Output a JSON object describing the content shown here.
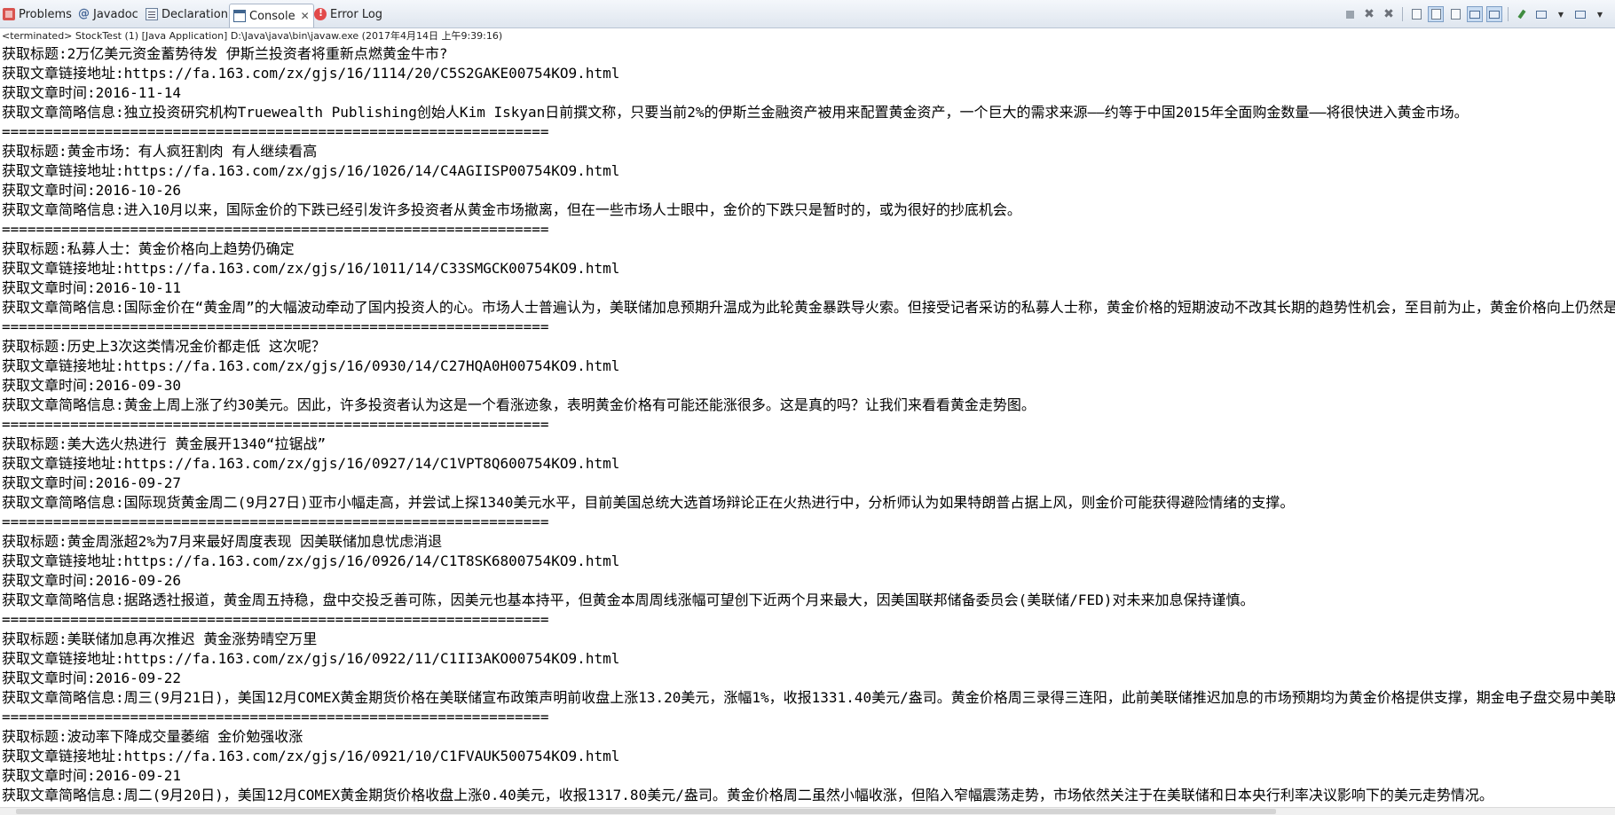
{
  "tabs": [
    {
      "label": "Problems",
      "icon": "problems-icon"
    },
    {
      "label": "Javadoc",
      "icon": "javadoc-icon"
    },
    {
      "label": "Declaration",
      "icon": "declaration-icon"
    },
    {
      "label": "Console",
      "icon": "console-icon",
      "active": true
    },
    {
      "label": "Error Log",
      "icon": "error-log-icon"
    }
  ],
  "status_line": "<terminated> StockTest (1) [Java Application] D:\\Java\\java\\bin\\javaw.exe (2017年4月14日 上午9:39:16)",
  "separator": "================================================================",
  "labels": {
    "title": "获取标题:",
    "link": "获取文章链接地址:",
    "time": "获取文章时间:",
    "summary": "获取文章简略信息:"
  },
  "articles": [
    {
      "title": "2万亿美元资金蓄势待发 伊斯兰投资者将重新点燃黄金牛市?",
      "link": "https://fa.163.com/zx/gjs/16/1114/20/C5S2GAKE00754KO9.html",
      "time": "2016-11-14",
      "summary": "独立投资研究机构Truewealth Publishing创始人Kim Iskyan日前撰文称，只要当前2%的伊斯兰金融资产被用来配置黄金资产，一个巨大的需求来源——约等于中国2015年全面购金数量——将很快进入黄金市场。"
    },
    {
      "title": "黄金市场：有人疯狂割肉 有人继续看高",
      "link": "https://fa.163.com/zx/gjs/16/1026/14/C4AGIISP00754KO9.html",
      "time": "2016-10-26",
      "summary": "进入10月以来，国际金价的下跌已经引发许多投资者从黄金市场撤离，但在一些市场人士眼中，金价的下跌只是暂时的，或为很好的抄底机会。"
    },
    {
      "title": "私募人士：黄金价格向上趋势仍确定",
      "link": "https://fa.163.com/zx/gjs/16/1011/14/C33SMGCK00754KO9.html",
      "time": "2016-10-11",
      "summary": "国际金价在“黄金周”的大幅波动牵动了国内投资人的心。市场人士普遍认为，美联储加息预期升温成为此轮黄金暴跌导火索。但接受记者采访的私募人士称，黄金价格的短期波动不改其长期的趋势性机会，至目前为止，黄金价格向上仍然是最确定的投资机会"
    },
    {
      "title": "历史上3次这类情况金价都走低 这次呢？",
      "link": "https://fa.163.com/zx/gjs/16/0930/14/C27HQA0H00754KO9.html",
      "time": "2016-09-30",
      "summary": "黄金上周上涨了约30美元。因此，许多投资者认为这是一个看涨迹象，表明黄金价格有可能还能涨很多。这是真的吗？让我们来看看黄金走势图。"
    },
    {
      "title": "美大选火热进行 黄金展开1340“拉锯战”",
      "link": "https://fa.163.com/zx/gjs/16/0927/14/C1VPT8Q600754KO9.html",
      "time": "2016-09-27",
      "summary": "国际现货黄金周二(9月27日)亚市小幅走高，并尝试上探1340美元水平，目前美国总统大选首场辩论正在火热进行中，分析师认为如果特朗普占据上风，则金价可能获得避险情绪的支撑。"
    },
    {
      "title": "黄金周涨超2%为7月来最好周度表现 因美联储加息忧虑消退",
      "link": "https://fa.163.com/zx/gjs/16/0926/14/C1T8SK6800754KO9.html",
      "time": "2016-09-26",
      "summary": "据路透社报道，黄金周五持稳，盘中交投乏善可陈，因美元也基本持平，但黄金本周周线涨幅可望创下近两个月来最大，因美国联邦储备委员会(美联储/FED)对未来加息保持谨慎。"
    },
    {
      "title": "美联储加息再次推迟 黄金涨势晴空万里",
      "link": "https://fa.163.com/zx/gjs/16/0922/11/C1II3AKO00754KO9.html",
      "time": "2016-09-22",
      "summary": "周三(9月21日)，美国12月COMEX黄金期货价格在美联储宣布政策声明前收盘上涨13.20美元，涨幅1%，收报1331.40美元/盎司。黄金价格周三录得三连阳，此前美联储推迟加息的市场预期均为黄金价格提供支撑，期金电子盘交易中美联储的按兵不动"
    },
    {
      "title": "波动率下降成交量萎缩 金价勉强收涨",
      "link": "https://fa.163.com/zx/gjs/16/0921/10/C1FVAUK500754KO9.html",
      "time": "2016-09-21",
      "summary": "周二(9月20日)，美国12月COMEX黄金期货价格收盘上涨0.40美元，收报1317.80美元/盎司。黄金价格周二虽然小幅收涨，但陷入窄幅震荡走势，市场依然关注于在美联储和日本央行利率决议影响下的美元走势情况。"
    }
  ]
}
